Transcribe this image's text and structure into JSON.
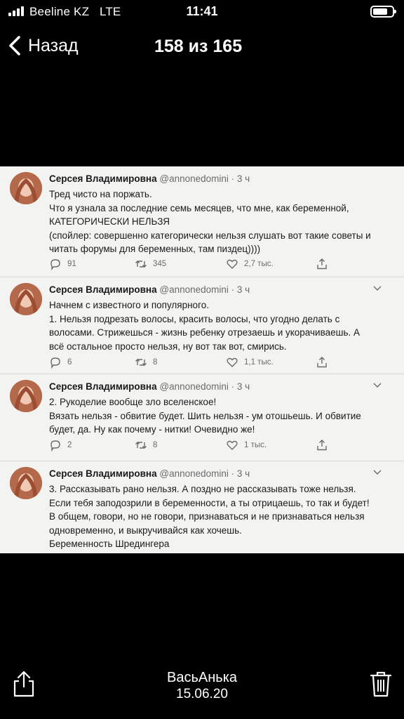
{
  "status_bar": {
    "carrier": "Beeline KZ",
    "network": "LTE",
    "time": "11:41"
  },
  "nav": {
    "back_label": "Назад",
    "counter": "158 из 165"
  },
  "tweets": [
    {
      "name": "Серсея Владимировна",
      "handle": "@annonedomini · 3 ч",
      "lines": [
        "Тред чисто на поржать.",
        "Что я узнала за последние семь месяцев, что мне, как беременной,",
        "КАТЕГОРИЧЕСКИ НЕЛЬЗЯ",
        "(спойлер: совершенно категорически нельзя слушать вот такие советы и",
        "читать форумы для беременных, там пиздец))))"
      ],
      "replies": "91",
      "retweets": "345",
      "likes": "2,7 тыс."
    },
    {
      "name": "Серсея Владимировна",
      "handle": "@annonedomini · 3 ч",
      "lines": [
        "Начнем с известного и популярного.",
        "1. Нельзя подрезать волосы, красить волосы, что угодно делать с",
        "волосами. Стрижешься - жизнь ребенку отрезаешь и укорачиваешь. А",
        "всё остальное просто нельзя, ну вот так вот, смирись."
      ],
      "replies": "6",
      "retweets": "8",
      "likes": "1,1 тыс."
    },
    {
      "name": "Серсея Владимировна",
      "handle": "@annonedomini · 3 ч",
      "lines": [
        "2. Рукоделие вообще зло вселенское!",
        "Вязать нельзя - обвитие будет. Шить нельзя - ум отошьешь. И обвитие",
        "будет, да. Ну как почему - нитки! Очевидно же!"
      ],
      "replies": "2",
      "retweets": "8",
      "likes": "1 тыс."
    },
    {
      "name": "Серсея Владимировна",
      "handle": "@annonedomini · 3 ч",
      "lines": [
        "3. Рассказывать рано нельзя. А поздно не рассказывать тоже нельзя.",
        "Если тебя заподозрили в беременности, а ты отрицаешь, то так и будет!",
        "В общем, говори, но не говори, признаваться и не признаваться нельзя",
        "одновременно, и выкручивайся как хочешь.",
        "Беременность Шредингера"
      ]
    }
  ],
  "footer": {
    "author": "ВасьАнька",
    "date": "15.06.20"
  }
}
